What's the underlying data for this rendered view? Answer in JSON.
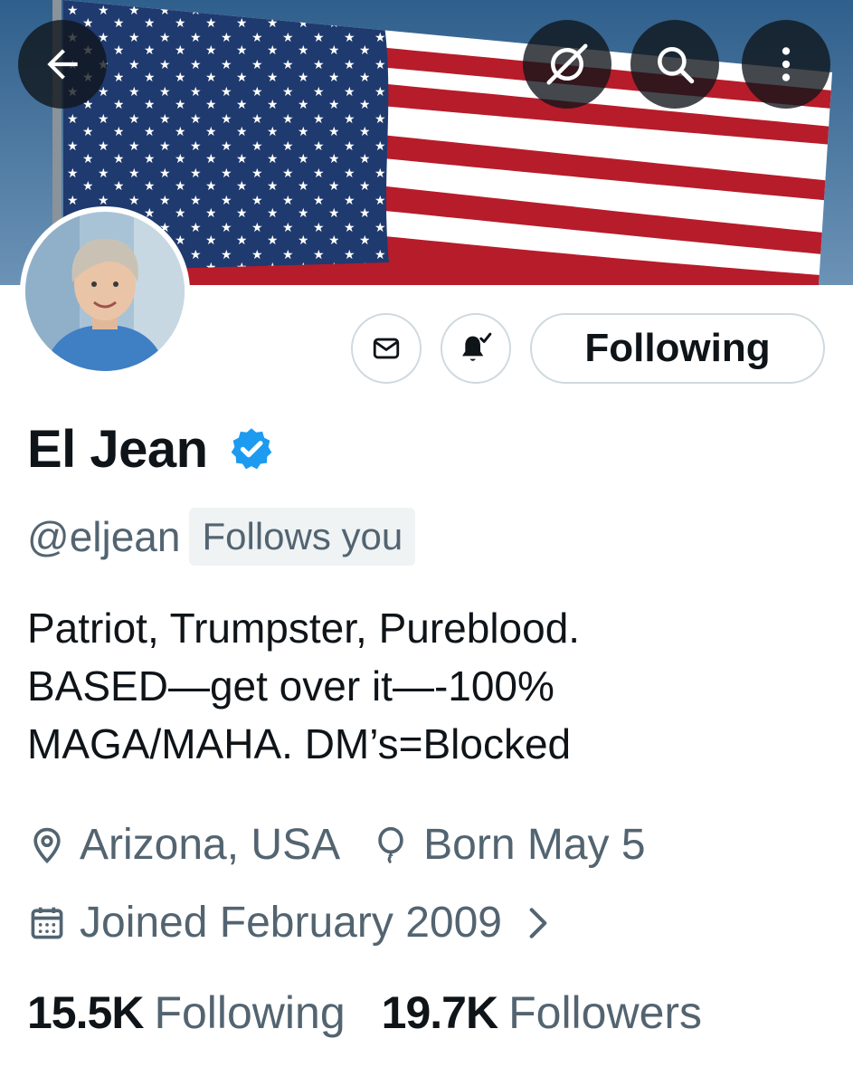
{
  "header": {
    "back_icon": "arrow-left-icon",
    "grok_icon": "grok-icon",
    "search_icon": "search-icon",
    "more_icon": "more-vertical-icon",
    "banner_description_icon": "american-flag-banner"
  },
  "actions": {
    "message_icon": "envelope-icon",
    "notify_icon": "bell-check-icon",
    "following_label": "Following"
  },
  "profile": {
    "name": "El Jean",
    "verified_icon": "verified-badge-icon",
    "handle": "@eljean",
    "follows_you": "Follows you",
    "bio_lines": [
      "Patriot, Trumpster, Pureblood.",
      "BASED—get over it—-100%",
      "MAGA/MAHA. DM’s=Blocked"
    ],
    "location": "Arizona, USA",
    "birthday": "Born May 5",
    "joined": "Joined February 2009",
    "following_count": "15.5K",
    "following_label": "Following",
    "followers_count": "19.7K",
    "followers_label": "Followers"
  },
  "colors": {
    "text_primary": "#0f1419",
    "text_secondary": "#536471",
    "verified_blue": "#1d9bf0",
    "border": "#cfd9de"
  }
}
